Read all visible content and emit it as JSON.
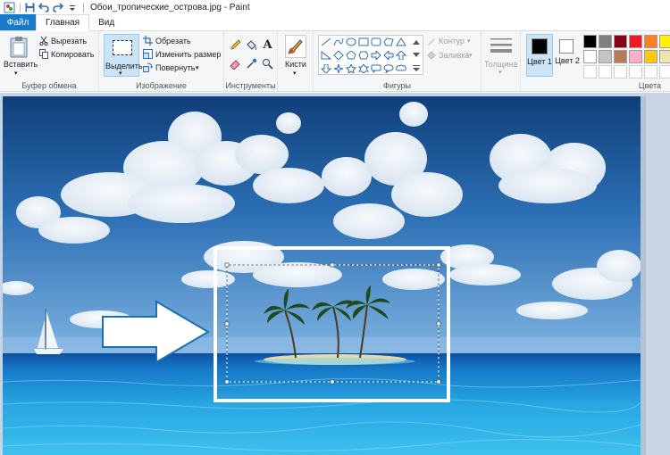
{
  "app": {
    "title": "Обои_тропические_острова.jpg - Paint"
  },
  "tabs": {
    "file": "Файл",
    "home": "Главная",
    "view": "Вид"
  },
  "clipboard": {
    "paste": "Вставить",
    "cut": "Вырезать",
    "copy": "Копировать",
    "label": "Буфер обмена"
  },
  "image": {
    "select": "Выделить",
    "crop": "Обрезать",
    "resize": "Изменить размер",
    "rotate": "Повернуть",
    "label": "Изображение"
  },
  "tools": {
    "label": "Инструменты",
    "brushes": "Кисти"
  },
  "shapes": {
    "label": "Фигуры",
    "outline": "Контур",
    "fill": "Заливка"
  },
  "size": {
    "label": "Толщина"
  },
  "colors": {
    "color1": "Цвет 1",
    "color2": "Цвет 2",
    "label": "Цвета",
    "color1_value": "#000000",
    "color2_value": "#ffffff",
    "palette": [
      "#000000",
      "#7f7f7f",
      "#880015",
      "#ed1c24",
      "#ff7f27",
      "#fff200",
      "#ffffff",
      "#c3c3c3",
      "#b97a57",
      "#ffaec9",
      "#ffc90e",
      "#efe4b0"
    ]
  }
}
